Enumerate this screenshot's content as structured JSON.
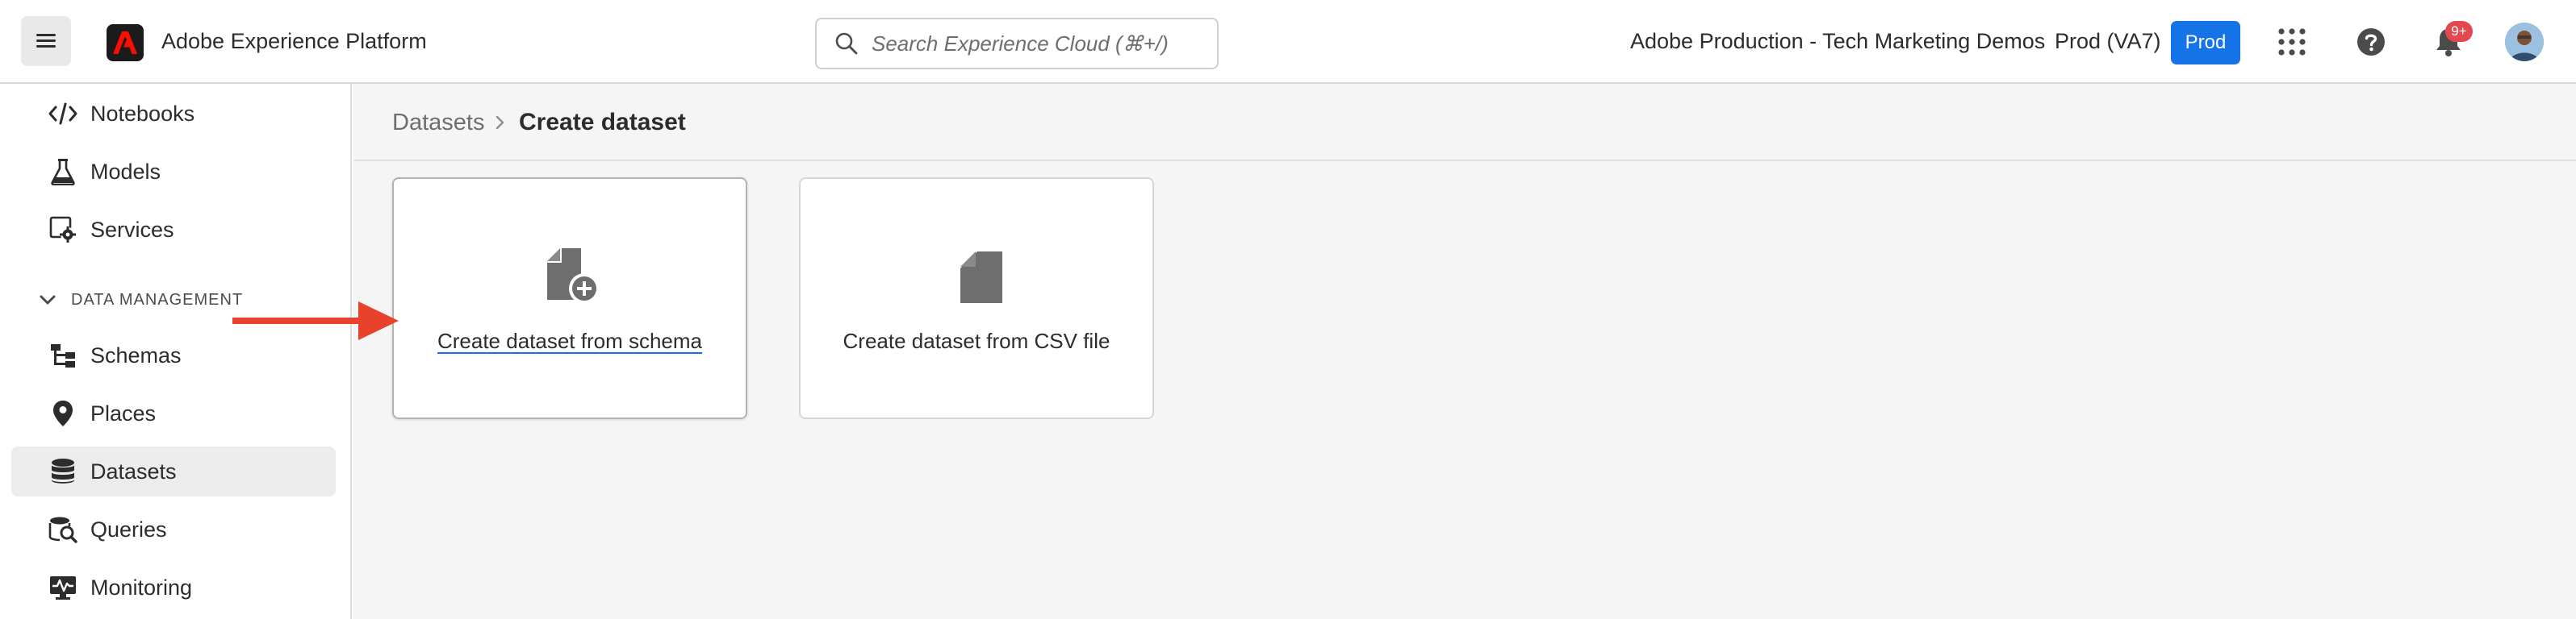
{
  "topbar": {
    "app_name": "Adobe Experience Platform",
    "search_placeholder": "Search Experience Cloud (⌘+/)",
    "org_name": "Adobe Production - Tech Marketing Demos",
    "sandbox_name": "Prod (VA7)",
    "sandbox_badge": "Prod",
    "notification_count": "9+",
    "accent_color": "#1473e6",
    "badge_color": "#e34850"
  },
  "sidebar": {
    "items_top": [
      {
        "label": "Notebooks",
        "icon": "code-icon"
      },
      {
        "label": "Models",
        "icon": "flask-icon"
      },
      {
        "label": "Services",
        "icon": "services-icon"
      }
    ],
    "section_label": "DATA MANAGEMENT",
    "items_data": [
      {
        "label": "Schemas",
        "icon": "schema-icon"
      },
      {
        "label": "Places",
        "icon": "location-pin-icon"
      },
      {
        "label": "Datasets",
        "icon": "database-icon",
        "active": true
      },
      {
        "label": "Queries",
        "icon": "query-icon"
      },
      {
        "label": "Monitoring",
        "icon": "monitoring-icon"
      }
    ]
  },
  "main": {
    "breadcrumb": [
      "Datasets",
      "Create dataset"
    ],
    "cards": [
      {
        "label": "Create dataset from schema",
        "icon": "file-add-icon"
      },
      {
        "label": "Create dataset from CSV file",
        "icon": "file-icon"
      }
    ]
  },
  "annotation": {
    "arrow_color": "#e8412c"
  }
}
